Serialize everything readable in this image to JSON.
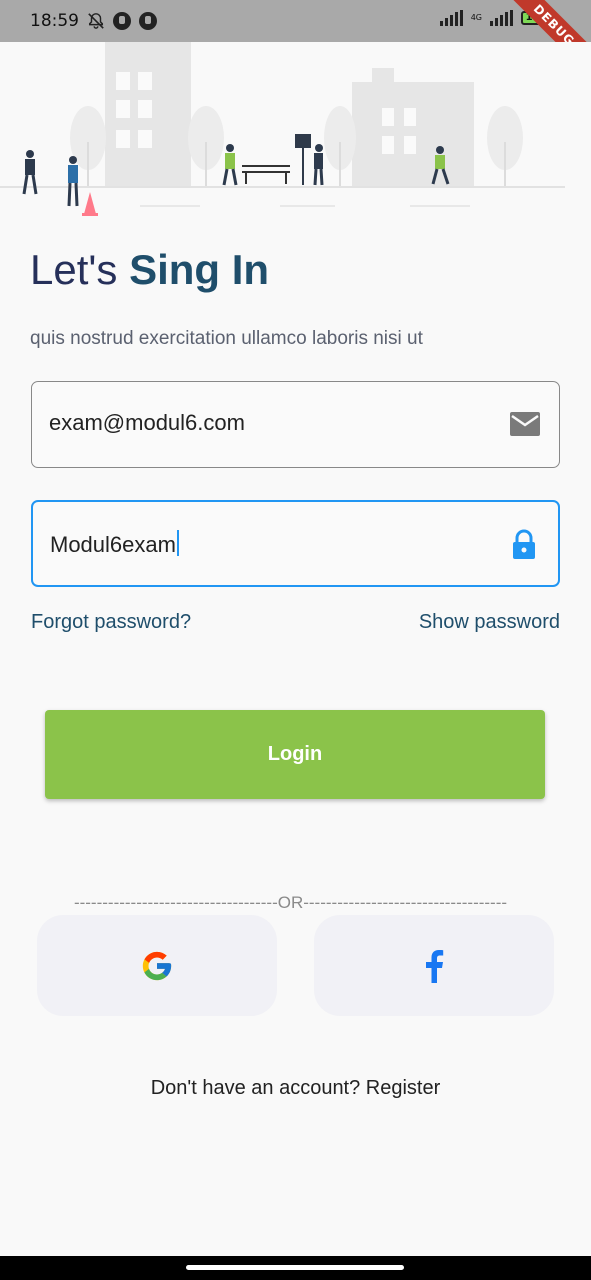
{
  "status_bar": {
    "time": "18:59",
    "network": "4G",
    "battery": "100"
  },
  "debug_banner": "DEBUG",
  "heading": {
    "prefix": "Let's",
    "emphasis": "Sing In"
  },
  "subtitle": "quis nostrud exercitation ullamco laboris nisi ut",
  "email_field": {
    "value": "exam@modul6.com",
    "icon": "mail-icon"
  },
  "password_field": {
    "value": "Modul6exam",
    "icon": "lock-icon",
    "focused": true
  },
  "links": {
    "forgot": "Forgot password?",
    "show": "Show password"
  },
  "login_button": "Login",
  "divider": "------------------------------------OR------------------------------------",
  "social": {
    "google_icon": "google-icon",
    "facebook_icon": "facebook-icon"
  },
  "register_text": "Don't have an account? Register",
  "colors": {
    "accent": "#2196f3",
    "login": "#8bc34a",
    "heading": "#1f4e6b"
  }
}
